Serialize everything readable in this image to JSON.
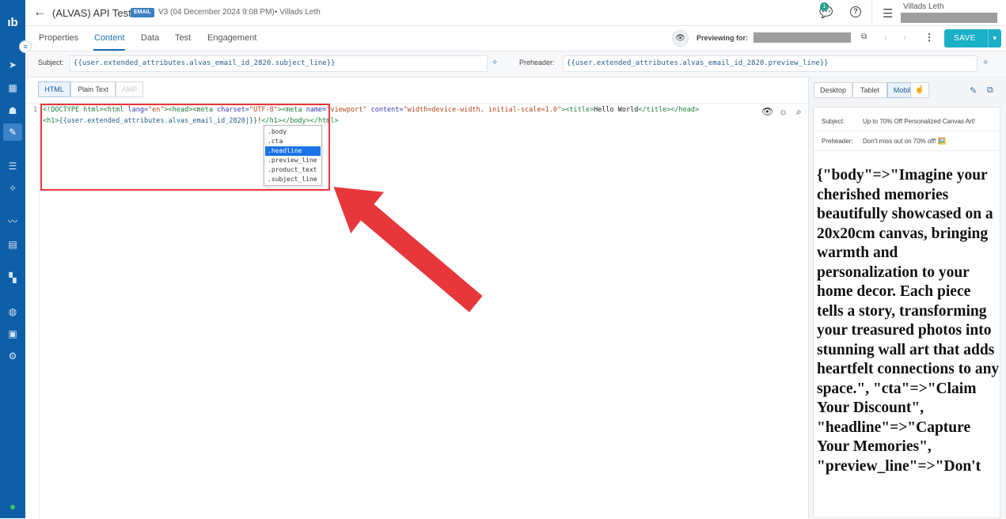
{
  "app": {
    "logo_text": "ıb"
  },
  "header": {
    "title": "(ALVAS) API Test",
    "badge": "EMAIL",
    "version": "V3 (04 December 2024 9:08 PM)",
    "author": "• Villads Leth",
    "notification_count": "1",
    "user_name": "Villads Leth"
  },
  "tabs": [
    "Properties",
    "Content",
    "Data",
    "Test",
    "Engagement"
  ],
  "preview_bar": {
    "label": "Previewing for:",
    "save_label": "SAVE"
  },
  "fields": {
    "subject_label": "Subject:",
    "subject_value": "{{user.extended_attributes.alvas_email_id_2820.subject_line}}",
    "preheader_label": "Preheader:",
    "preheader_value": "{{user.extended_attributes.alvas_email_id_2820.preview_line}}"
  },
  "editor_modes": [
    "HTML",
    "Plain Text",
    "AMP"
  ],
  "editor": {
    "line_number": "1",
    "line1": [
      {
        "t": "tag",
        "v": "<!DOCTYPE html><html "
      },
      {
        "t": "attr",
        "v": "lang="
      },
      {
        "t": "val",
        "v": "\"en\""
      },
      {
        "t": "tag",
        "v": "><head><meta "
      },
      {
        "t": "attr",
        "v": "charset="
      },
      {
        "t": "val",
        "v": "\"UTF-8\""
      },
      {
        "t": "tag",
        "v": "><meta "
      },
      {
        "t": "attr",
        "v": "name="
      },
      {
        "t": "val",
        "v": "\"viewport\" "
      },
      {
        "t": "attr",
        "v": "content="
      },
      {
        "t": "val",
        "v": "\"width=device-width, initial-scale=1.0\""
      },
      {
        "t": "tag",
        "v": "><title>"
      },
      {
        "t": "text",
        "v": "Hello World"
      },
      {
        "t": "tag",
        "v": "</title></head>"
      }
    ],
    "line2": [
      {
        "t": "tag",
        "v": "<h1>"
      },
      {
        "t": "liquid",
        "v": "{{user.extended_attributes.alvas_email_id_2820|}}"
      },
      {
        "t": "text",
        "v": "!"
      },
      {
        "t": "tag",
        "v": "</h1></body></html>"
      }
    ],
    "autocomplete": [
      ".body",
      ".cta",
      ".headline",
      ".preview_line",
      ".product_text",
      ".subject_line"
    ],
    "selected_index": 2
  },
  "preview_panel": {
    "devices": [
      "Desktop",
      "Tablet",
      "Mobile"
    ],
    "active_device": "Mobile",
    "subject_label": "Subject:",
    "subject_value": "Up to 70% Off Personalized Canvas Art!",
    "preheader_label": "Preheader:",
    "preheader_value": "Don't miss out on 70% off! 🖼️",
    "body_text": "{\"body\"=>\"Imagine your cherished memories beautifully showcased on a 20x20cm canvas, bringing warmth and personalization to your home decor. Each piece tells a story, transforming your treasured photos into stunning wall art that adds heartfelt connections to any space.\", \"cta\"=>\"Claim Your Discount\", \"headline\"=>\"Capture Your Memories\", \"preview_line\"=>\"Don't"
  },
  "colors": {
    "rail": "#0f5fa8",
    "accent": "#1ab0c6",
    "highlight": "#e8373b"
  }
}
